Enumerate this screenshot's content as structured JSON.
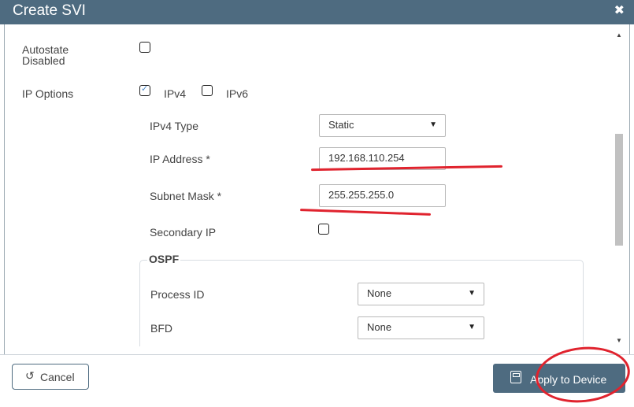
{
  "dialog": {
    "title": "Create SVI"
  },
  "form": {
    "autostate": {
      "label_line1": "Autostate",
      "label_line2": "Disabled",
      "checked": false
    },
    "ip_options": {
      "label": "IP Options",
      "ipv4": "IPv4",
      "ipv6": "IPv6",
      "ipv4_checked": true,
      "ipv6_checked": false
    },
    "ipv4_type": {
      "label": "IPv4 Type",
      "value": "Static"
    },
    "ip_address": {
      "label": "IP Address *",
      "value": "192.168.110.254"
    },
    "subnet_mask": {
      "label": "Subnet Mask *",
      "value": "255.255.255.0"
    },
    "secondary_ip": {
      "label": "Secondary IP",
      "checked": false
    },
    "ospf": {
      "title": "OSPF",
      "process_id": {
        "label": "Process ID",
        "value": "None"
      },
      "bfd": {
        "label": "BFD",
        "value": "None"
      }
    }
  },
  "footer": {
    "cancel_label": "Cancel",
    "apply_label": "Apply to Device"
  },
  "colors": {
    "header": "#4e6b80",
    "annotation": "#e0232e"
  }
}
